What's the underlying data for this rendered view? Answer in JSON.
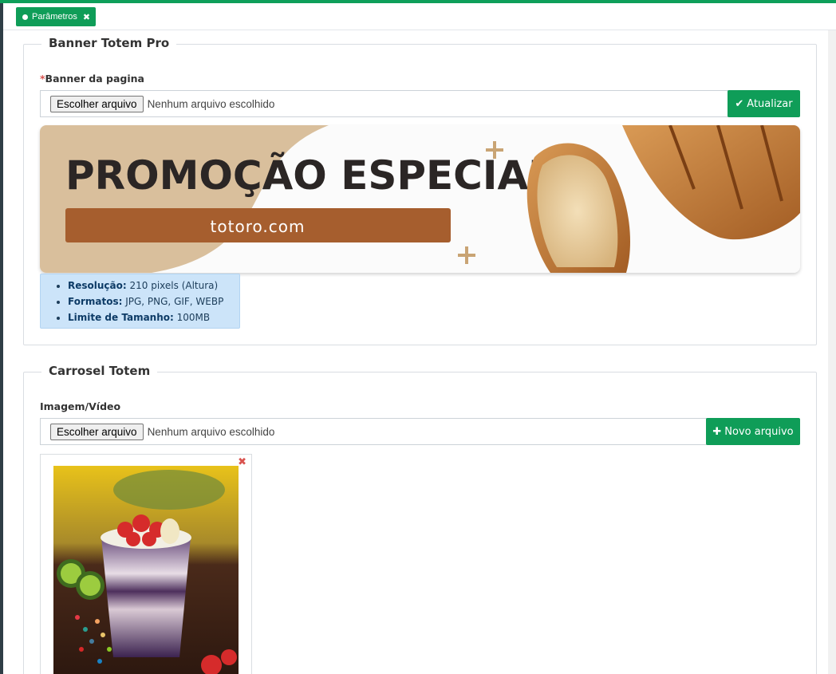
{
  "tab": {
    "label": "Parâmetros",
    "close_glyph": "✖"
  },
  "banner_section": {
    "legend": "Banner Totem Pro",
    "required_mark": "*",
    "field_label": "Banner da pagina",
    "file_button": "Escolher arquivo",
    "file_status": "Nenhum arquivo escolhido",
    "action_icon": "✔",
    "action_label": "Atualizar",
    "banner_image": {
      "headline": "PROMOÇÃO ESPECIAL",
      "url_text": "totoro.com"
    },
    "info": [
      {
        "key": "Resolução:",
        "value": " 210 pixels (Altura)"
      },
      {
        "key": "Formatos:",
        "value": " JPG, PNG, GIF, WEBP"
      },
      {
        "key": "Limite de Tamanho:",
        "value": " 100MB"
      }
    ]
  },
  "carousel_section": {
    "legend": "Carrosel Totem",
    "field_label": "Imagem/Vídeo",
    "file_button": "Escolher arquivo",
    "file_status": "Nenhum arquivo escolhido",
    "action_icon": "✚",
    "action_label": "Novo arquivo",
    "thumb_close_glyph": "✖"
  },
  "colors": {
    "accent_green": "#0f9d58",
    "info_bg": "#cce4f9",
    "required_red": "#d9534f",
    "banner_tan": "#d9bf9c",
    "banner_brown": "#a65e2e"
  }
}
